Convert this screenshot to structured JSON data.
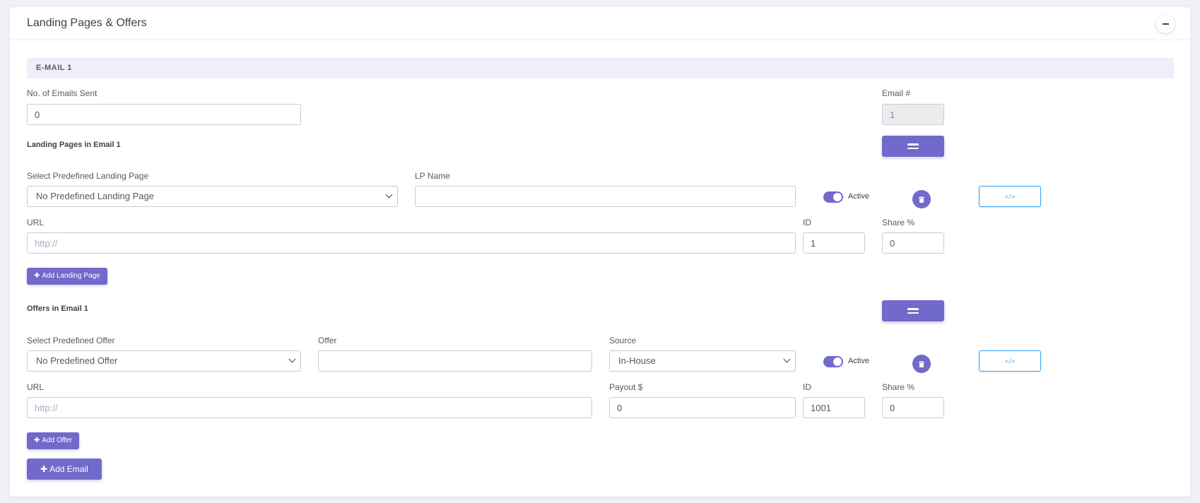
{
  "card": {
    "title": "Landing Pages & Offers"
  },
  "email_section": {
    "title": "E-MAIL 1"
  },
  "emails_sent": {
    "label": "No. of Emails Sent",
    "value": "0"
  },
  "email_number": {
    "label": "Email #",
    "value": "1"
  },
  "landing_pages": {
    "heading": "Landing Pages in Email 1",
    "select_label": "Select Predefined Landing Page",
    "select_value": "No Predefined Landing Page",
    "name_label": "LP Name",
    "name_value": "",
    "active_label": "Active",
    "url_label": "URL",
    "url_placeholder": "http://",
    "id_label": "ID",
    "id_value": "1",
    "share_label": "Share %",
    "share_value": "0",
    "add_button": "Add Landing Page"
  },
  "offers": {
    "heading": "Offers in Email 1",
    "select_label": "Select Predefined Offer",
    "select_value": "No Predefined Offer",
    "offer_label": "Offer",
    "offer_value": "",
    "source_label": "Source",
    "source_value": "In-House",
    "active_label": "Active",
    "url_label": "URL",
    "url_placeholder": "http://",
    "payout_label": "Payout $",
    "payout_value": "0",
    "id_label": "ID",
    "id_value": "1001",
    "share_label": "Share %",
    "share_value": "0",
    "add_button": "Add Offer"
  },
  "add_email_button": "Add Email",
  "icons": {
    "collapse": "minus-icon",
    "drag": "drag-handle-icon",
    "delete": "trash-icon",
    "code": "code-icon",
    "plus": "plus-icon",
    "chevron": "chevron-down-icon"
  },
  "colors": {
    "accent": "#716aca",
    "code_border": "#36a3f7",
    "section_bg": "#f0eff9",
    "page_bg": "#f0f0f7"
  }
}
